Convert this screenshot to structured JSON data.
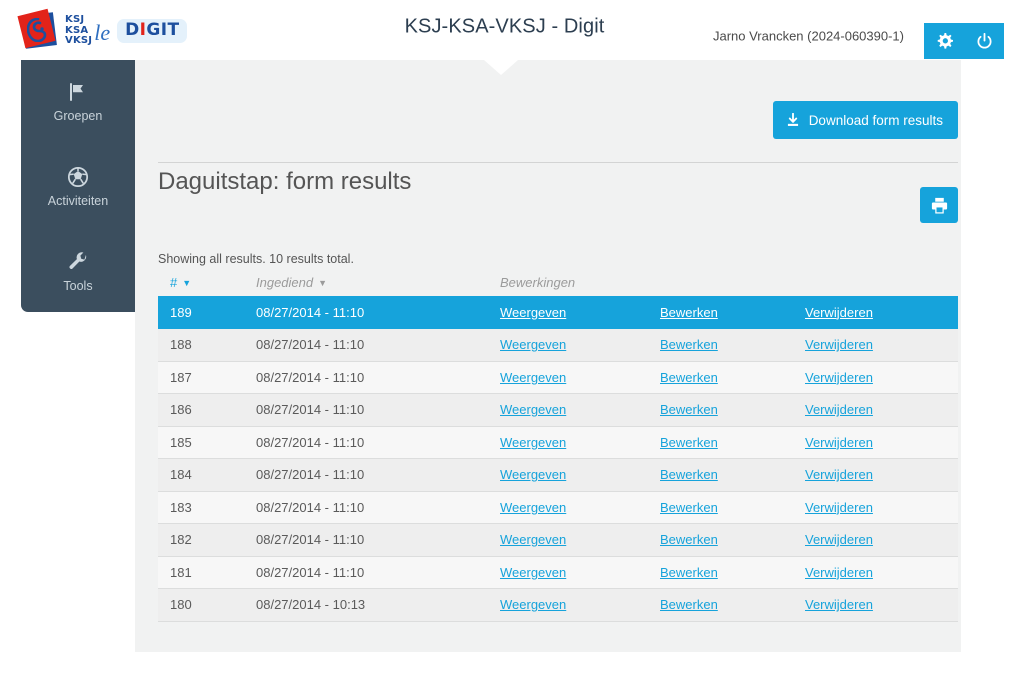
{
  "header": {
    "logo": {
      "emblem_lines": [
        "KSJ",
        "KSA",
        "VKSJ"
      ],
      "script_word": "le",
      "badge_d": "D",
      "badge_i": "I",
      "badge_git": "GIT"
    },
    "title": "KSJ-KSA-VKSJ - Digit",
    "user": "Jarno Vrancken (2024-060390-1)",
    "settings_icon": "gear-icon",
    "logout_icon": "power-icon",
    "accent_color": "#16a3db"
  },
  "sidebar": {
    "items": [
      {
        "label": "Groepen",
        "icon": "flag-icon"
      },
      {
        "label": "Activiteiten",
        "icon": "soccer-ball-icon"
      },
      {
        "label": "Tools",
        "icon": "wrench-icon"
      }
    ]
  },
  "main": {
    "page_title": "Daguitstap: form results",
    "download_label": "Download form results",
    "download_icon": "download-icon",
    "print_icon": "printer-icon",
    "results_note": "Showing all results. 10 results total.",
    "table": {
      "columns": [
        "#",
        "Ingediend",
        "Bewerkingen",
        ""
      ],
      "sort_carets": [
        "▼",
        "▼"
      ],
      "rows": [
        {
          "num": "189",
          "submitted": "08/27/2014 - 11:10",
          "view": "Weergeven",
          "edit": "Bewerken",
          "delete": "Verwijderen",
          "selected": true
        },
        {
          "num": "188",
          "submitted": "08/27/2014 - 11:10",
          "view": "Weergeven",
          "edit": "Bewerken",
          "delete": "Verwijderen",
          "selected": false
        },
        {
          "num": "187",
          "submitted": "08/27/2014 - 11:10",
          "view": "Weergeven",
          "edit": "Bewerken",
          "delete": "Verwijderen",
          "selected": false
        },
        {
          "num": "186",
          "submitted": "08/27/2014 - 11:10",
          "view": "Weergeven",
          "edit": "Bewerken",
          "delete": "Verwijderen",
          "selected": false
        },
        {
          "num": "185",
          "submitted": "08/27/2014 - 11:10",
          "view": "Weergeven",
          "edit": "Bewerken",
          "delete": "Verwijderen",
          "selected": false
        },
        {
          "num": "184",
          "submitted": "08/27/2014 - 11:10",
          "view": "Weergeven",
          "edit": "Bewerken",
          "delete": "Verwijderen",
          "selected": false
        },
        {
          "num": "183",
          "submitted": "08/27/2014 - 11:10",
          "view": "Weergeven",
          "edit": "Bewerken",
          "delete": "Verwijderen",
          "selected": false
        },
        {
          "num": "182",
          "submitted": "08/27/2014 - 11:10",
          "view": "Weergeven",
          "edit": "Bewerken",
          "delete": "Verwijderen",
          "selected": false
        },
        {
          "num": "181",
          "submitted": "08/27/2014 - 11:10",
          "view": "Weergeven",
          "edit": "Bewerken",
          "delete": "Verwijderen",
          "selected": false
        },
        {
          "num": "180",
          "submitted": "08/27/2014 - 10:13",
          "view": "Weergeven",
          "edit": "Bewerken",
          "delete": "Verwijderen",
          "selected": false
        }
      ]
    }
  }
}
